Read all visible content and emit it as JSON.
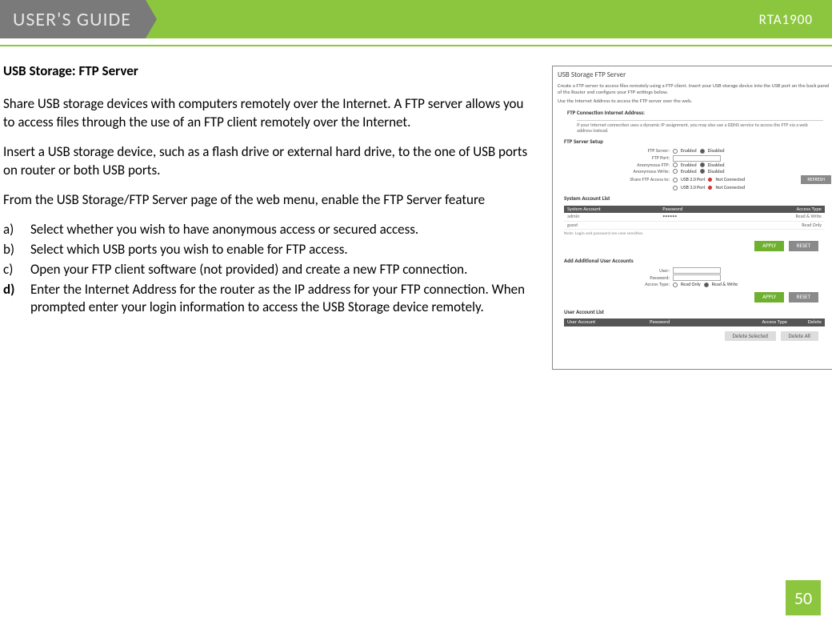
{
  "header": {
    "title": "USER'S GUIDE",
    "model": "RTA1900"
  },
  "section_title": "USB Storage: FTP Server",
  "paragraphs": {
    "p1": "Share USB storage devices with computers remotely over the Internet. A FTP server allows you to access files through the use of an FTP client remotely over the Internet.",
    "p2": "Insert a USB storage device, such as a flash drive or external hard drive, to the one of USB ports on router or both USB ports.",
    "p3": "From the USB Storage/FTP Server page of the web menu, enable the FTP Server feature"
  },
  "steps": {
    "a": {
      "marker": "a)",
      "text": "Select whether you wish to have anonymous access or secured access."
    },
    "b": {
      "marker": "b)",
      "text": "Select which USB ports you wish to enable for FTP access."
    },
    "c": {
      "marker": "c)",
      "text": "Open your FTP client software (not provided) and create a new FTP connection."
    },
    "d": {
      "marker": "d)",
      "text": "Enter the Internet Address for the router as the IP address for your FTP connection.  When prompted enter your login information to access the USB Storage device remotely."
    }
  },
  "screenshot": {
    "title": "USB Storage FTP Server",
    "desc1": "Create a FTP server to access files remotely using a FTP client. Insert your USB storage device into the USB port on the back panel of the Router and configure your FTP settings below.",
    "desc2": "Use the Internet Address to access the FTP server over the web.",
    "conn_head": "FTP Connection Internet Address:",
    "conn_note": "If your Internet connection uses a dynamic IP assignment, you may also use a DDNS service to access the FTP via a web address instead.",
    "setup_head": "FTP Server Setup",
    "rows": {
      "server": "FTP Server:",
      "port": "FTP Port:",
      "anon_ftp": "Anonymous FTP:",
      "anon_write": "Anonymous Write:",
      "share": "Share FTP Access to:"
    },
    "opts": {
      "enabled": "Enabled",
      "disabled": "Disabled",
      "usb2": "USB 2.0 Port",
      "usb3": "USB 3.0 Port",
      "notconn": "Not Connected"
    },
    "refresh": "REFRESH",
    "sys_list_head": "System Account List",
    "cols": {
      "sys_acct": "System Account",
      "password": "Password",
      "access": "Access Type",
      "user_acct": "User Account",
      "delete": "Delete"
    },
    "sys_rows": {
      "admin": "admin",
      "admin_access": "Read & Write",
      "guest": "guest",
      "guest_access": "Read Only",
      "dots": "••••••"
    },
    "note": "Note: Login and password are case sensitive.",
    "apply": "APPLY",
    "reset": "RESET",
    "add_head": "Add Additional User Accounts",
    "add": {
      "user": "User:",
      "password": "Password:",
      "access_type": "Access Type:",
      "read_only": "Read Only",
      "read_write": "Read & Write"
    },
    "user_list_head": "User Account List",
    "del_sel": "Delete Selected",
    "del_all": "Delete All"
  },
  "page_number": "50"
}
